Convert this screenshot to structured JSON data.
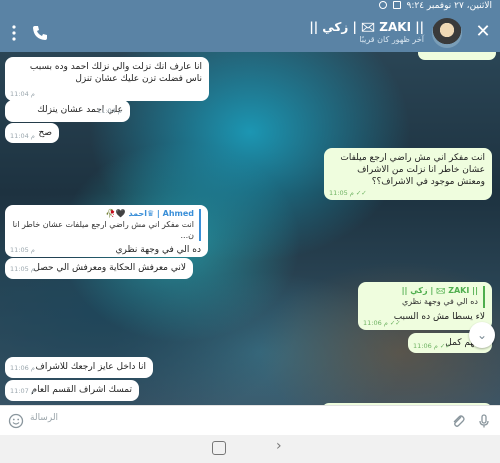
{
  "status_bar": {
    "date_time": "الاثنين، ٢٧ نوفمبر ٩:٢٤",
    "image_icon": "image-icon",
    "notification_icon": "notification-icon"
  },
  "header": {
    "title": "‏|| ZAKI 🖂 | زكي ||",
    "subtitle": "آخر ظهور كان قريبًا",
    "close_icon": "close-icon",
    "phone_icon": "phone-icon",
    "menu_icon": "more-vertical-icon"
  },
  "messages": [
    {
      "id": "m1",
      "dir": "in",
      "text": "انا عارف انك نزلت والي نزلك احمد وده بسبب ناس فضلت تزن عليك عشان تنزل",
      "time": "11:04 م"
    },
    {
      "id": "m2",
      "dir": "in",
      "text": "علي احمد عشان ينزلك",
      "time": "11:04 م"
    },
    {
      "id": "m3",
      "dir": "in",
      "text": "صح",
      "time": "11:04 م"
    },
    {
      "id": "m4",
      "dir": "out",
      "text": "انت مفكر اني مش راضي ارجع ميلفات عشان خاطر انا نزلت من الاشراف ومعتش موجود في الاشراف؟؟",
      "time": "11:05 م"
    },
    {
      "id": "m5",
      "dir": "in",
      "quote_name": "Ahmed | ♛احمد 🖤🥀",
      "quote_text": "انت مفكر اني مش راضي ارجع ميلفات عشان خاطر انا ن...",
      "text": "ده الي في وجهة نظري",
      "time": "11:05 م"
    },
    {
      "id": "m6",
      "dir": "in",
      "text": "لاني معرفش الحكاية ومعرفش الي حصل",
      "time": "11:05 م"
    },
    {
      "id": "m7",
      "dir": "out",
      "quote_name": "|| ZAKI 🖂 | زكي ||",
      "quote_text": "ده الي في وجهة نظري",
      "text": "لاء يسطا مش ده السبب",
      "time": "11:06 م"
    },
    {
      "id": "m8",
      "dir": "out",
      "text": "المهم كمل",
      "time": "11:06 م"
    },
    {
      "id": "m9",
      "dir": "in",
      "text": "انا داخل عايز ارجعك للاشراف",
      "time": "11:06 م"
    },
    {
      "id": "m10",
      "dir": "in",
      "text": "تمسك اشراف القسم العام",
      "time": "11:07 م"
    }
  ],
  "scroll_down_icon": "chevron-down-icon",
  "composer": {
    "placeholder": "الرسالة",
    "emoji_icon": "emoji-icon",
    "attach_icon": "attach-icon",
    "mic_icon": "mic-icon"
  },
  "navbar": {
    "home_icon": "home-square-icon",
    "back_icon": "chevron-right-icon",
    "back_glyph": "›"
  }
}
